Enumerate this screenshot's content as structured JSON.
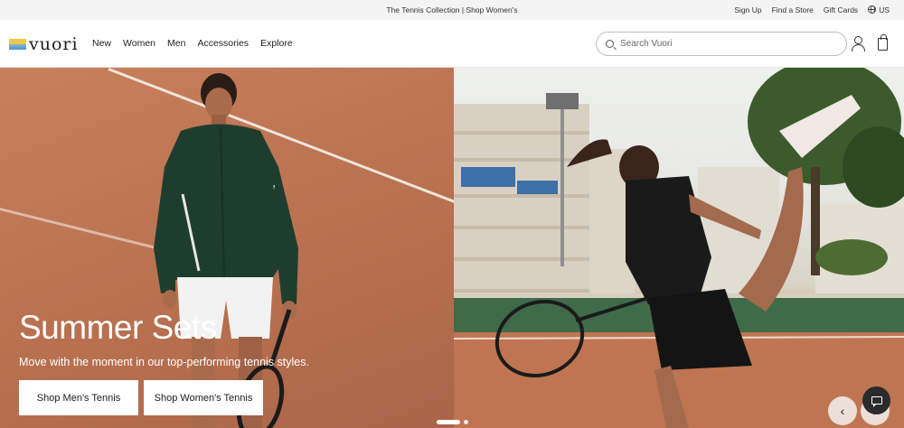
{
  "topbar": {
    "promo_text": "The Tennis Collection | Shop Women's",
    "sign_up": "Sign Up",
    "find_store": "Find a Store",
    "gift_cards": "Gift Cards",
    "region": "US"
  },
  "header": {
    "logo_text": "vuori",
    "nav": [
      "New",
      "Women",
      "Men",
      "Accessories",
      "Explore"
    ],
    "search_placeholder": "Search Vuori"
  },
  "hero": {
    "title": "Summer Sets",
    "subtitle": "Move with the moment in our top-performing tennis styles.",
    "cta_men": "Shop Men's Tennis",
    "cta_women": "Shop Women's Tennis",
    "slide_count": 2,
    "active_slide": 1
  },
  "colors": {
    "clay": "#bd7453",
    "jacket": "#1f3d2e",
    "sky": "#eef0ee",
    "chat_button": "#2b2b2b"
  },
  "icons": [
    "globe-icon",
    "search-icon",
    "account-icon",
    "bag-icon",
    "chevron-left-icon",
    "chevron-right-icon",
    "chat-icon"
  ]
}
